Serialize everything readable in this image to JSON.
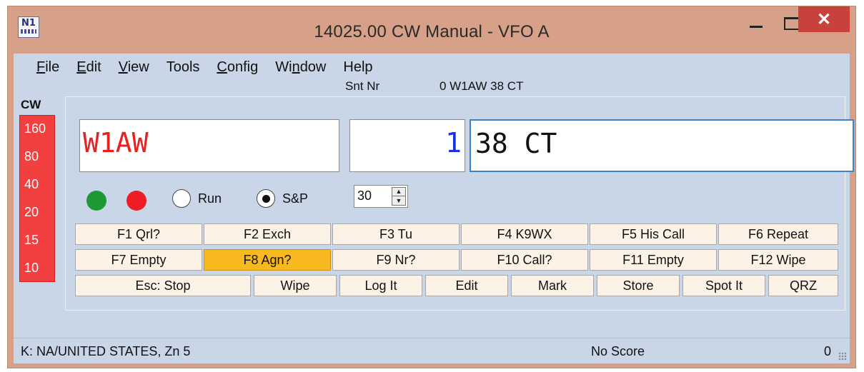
{
  "window": {
    "title": "14025.00 CW Manual - VFO A",
    "close_glyph": "✕",
    "logo_text": "N1"
  },
  "menu": [
    "File",
    "Edit",
    "View",
    "Tools",
    "Config",
    "Window",
    "Help"
  ],
  "info": {
    "sent_label": "Snt Nr",
    "sent_value": "0 W1AW 38 CT"
  },
  "band": {
    "mode": "CW",
    "items": [
      "160",
      "80",
      "40",
      "20",
      "15",
      "10"
    ]
  },
  "entry": {
    "call": "W1AW",
    "serial": "1",
    "exchange": "38 CT"
  },
  "controls": {
    "run_label": "Run",
    "sp_label": "S&P",
    "selected": "S&P",
    "speed": "30"
  },
  "fkeys_row1": [
    "F1 Qrl?",
    "F2 Exch",
    "F3 Tu",
    "F4 K9WX",
    "F5 His Call",
    "F6 Repeat"
  ],
  "fkeys_row2": [
    "F7 Empty",
    "F8 Agn?",
    "F9 Nr?",
    "F10 Call?",
    "F11 Empty",
    "F12 Wipe"
  ],
  "fkeys_active": "F8 Agn?",
  "actions": [
    "Esc: Stop",
    "Wipe",
    "Log It",
    "Edit",
    "Mark",
    "Store",
    "Spot It",
    "QRZ"
  ],
  "status": {
    "left": "K: NA/UNITED STATES, Zn 5",
    "middle": "No Score",
    "right": "0"
  },
  "colors": {
    "call_text": "#e82020",
    "serial_text": "#1a2fe0",
    "band_bg": "#f24040",
    "active_fkey": "#f7b820",
    "client_bg": "#c8d6e8"
  }
}
